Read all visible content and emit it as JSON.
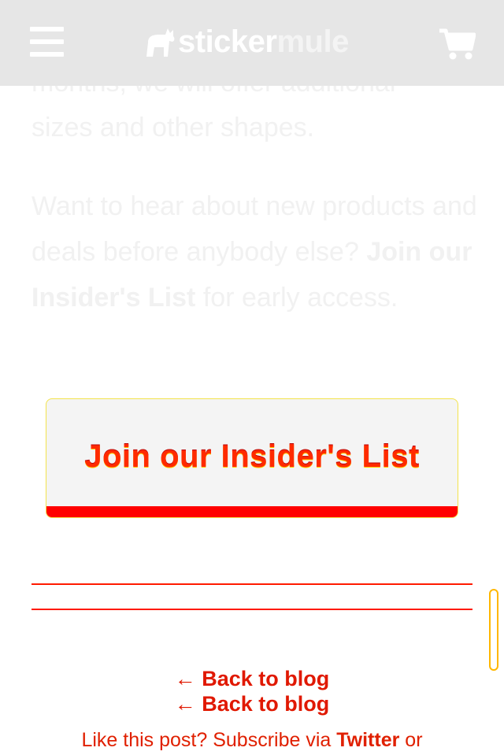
{
  "header": {
    "logo_part1": "sticker",
    "logo_part2": "mule"
  },
  "article": {
    "clipped_line": "months, we will offer additional",
    "para1_end": "sizes and other shapes.",
    "para2_start": "Want to hear about new products and deals before anybody else?",
    "para2_link": "Join our Insider's List",
    "para2_end": " for early access."
  },
  "cta": {
    "label": "Join our Insider's List"
  },
  "footer": {
    "back_link": "← Back to blog",
    "subscribe_prefix": "Like this post? Subscribe via ",
    "subscribe_twitter": "Twitter",
    "subscribe_suffix": " or"
  },
  "colors": {
    "header_bg": "#e6e6e6",
    "accent_red": "#ff0000",
    "link_red": "#e01800"
  }
}
